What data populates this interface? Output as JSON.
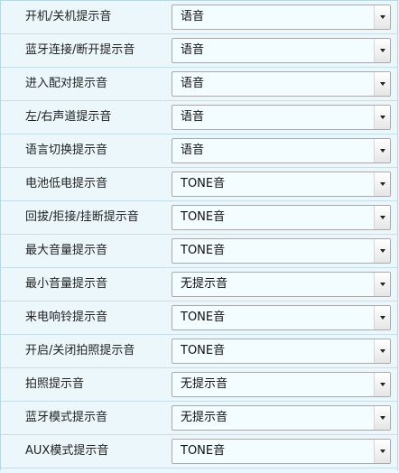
{
  "settings": {
    "rows": [
      {
        "label": "开机/关机提示音",
        "value": "语音"
      },
      {
        "label": "蓝牙连接/断开提示音",
        "value": "语音"
      },
      {
        "label": "进入配对提示音",
        "value": "语音"
      },
      {
        "label": "左/右声道提示音",
        "value": "语音"
      },
      {
        "label": "语言切换提示音",
        "value": "语音"
      },
      {
        "label": "电池低电提示音",
        "value": "TONE音"
      },
      {
        "label": "回拔/拒接/挂断提示音",
        "value": "TONE音"
      },
      {
        "label": "最大音量提示音",
        "value": "TONE音"
      },
      {
        "label": "最小音量提示音",
        "value": "无提示音"
      },
      {
        "label": "来电响铃提示音",
        "value": "TONE音"
      },
      {
        "label": "开启/关闭拍照提示音",
        "value": "TONE音"
      },
      {
        "label": "拍照提示音",
        "value": "无提示音"
      },
      {
        "label": "蓝牙模式提示音",
        "value": "无提示音"
      },
      {
        "label": "AUX模式提示音",
        "value": "TONE音"
      }
    ]
  }
}
